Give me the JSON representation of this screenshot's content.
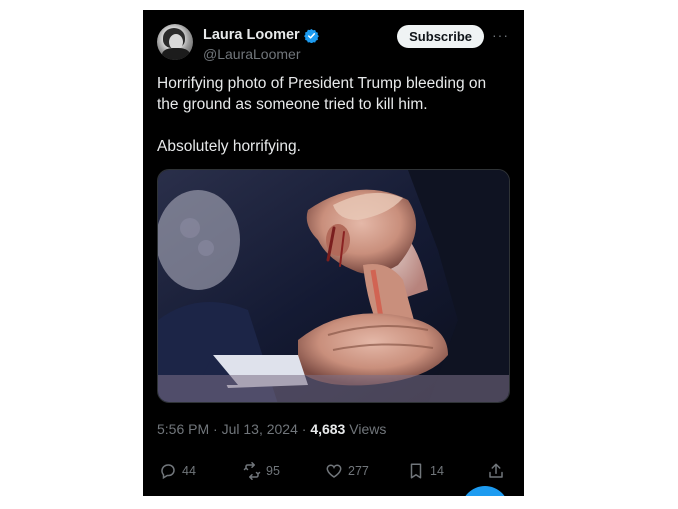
{
  "author": {
    "display_name": "Laura Loomer",
    "handle": "@LauraLoomer",
    "verified": true
  },
  "header": {
    "subscribe_label": "Subscribe",
    "more_icon": "more-horizontal-icon"
  },
  "tweet": {
    "line1": "Horrifying photo of President Trump bleeding on",
    "line2": "the ground as someone tried to kill him.",
    "line3": "Absolutely horrifying."
  },
  "meta": {
    "time": "5:56 PM · Jul 13, 2024 · ",
    "views_count": "4,683",
    "views_label": " Views"
  },
  "actions": {
    "replies": "44",
    "reposts": "95",
    "likes": "277",
    "bookmarks": "14"
  },
  "colors": {
    "background": "#000000",
    "text": "#e7e9ea",
    "muted": "#71767b",
    "verified": "#1d9bf0",
    "accent": "#1d9bf0"
  }
}
